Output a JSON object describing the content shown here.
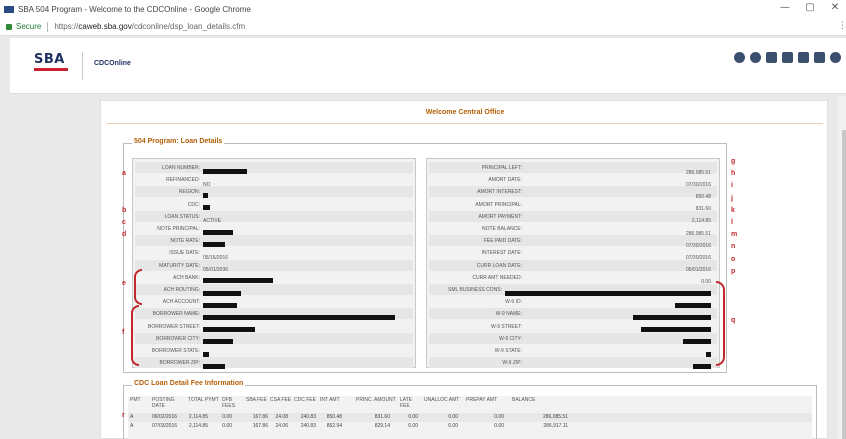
{
  "browser": {
    "window_title": "SBA 504 Program - Welcome to the CDCOnline - Google Chrome",
    "secure_label": "Secure",
    "url_prefix": "https://",
    "url_host": "caweb.sba.gov",
    "url_path": "/cdconline/dsp_loan_details.cfm"
  },
  "header": {
    "logo_text": "SBA",
    "app_name": "CDCOnline",
    "icons": [
      "user-icon",
      "help-icon",
      "chat-icon",
      "print-icon",
      "phone-icon",
      "home-icon",
      "logout-icon"
    ]
  },
  "page": {
    "welcome": "Welcome Central Office",
    "section_title": "504 Program: Loan Details",
    "fee_section_title": "CDC Loan Detail Fee Information"
  },
  "left_fields": [
    {
      "label": "LOAN NUMBER:",
      "value": "",
      "redact": 44
    },
    {
      "label": "REFINANCED:",
      "value": "NO",
      "redact": 0
    },
    {
      "label": "REGION:",
      "value": "",
      "redact": 5
    },
    {
      "label": "CDC:",
      "value": "",
      "redact": 7
    },
    {
      "label": "LOAN STATUS:",
      "value": "ACTIVE",
      "redact": 0
    },
    {
      "label": "NOTE PRINCIPAL:",
      "value": "",
      "redact": 30
    },
    {
      "label": "NOTE RATE:",
      "value": "",
      "redact": 22
    },
    {
      "label": "ISSUE DATE:",
      "value": "05/16/2016",
      "redact": 0
    },
    {
      "label": "MATURITY DATE:",
      "value": "05/01/2036",
      "redact": 0
    },
    {
      "label": "ACH BANK:",
      "value": "",
      "redact": 70
    },
    {
      "label": "ACH ROUTING:",
      "value": "",
      "redact": 38
    },
    {
      "label": "ACH ACCOUNT:",
      "value": "",
      "redact": 34
    },
    {
      "label": "BORROWER NAME:",
      "value": "",
      "redact": 192
    },
    {
      "label": "BORROWER STREET:",
      "value": "",
      "redact": 52
    },
    {
      "label": "BORROWER CITY:",
      "value": "",
      "redact": 30
    },
    {
      "label": "BORROWER STATE:",
      "value": "",
      "redact": 6
    },
    {
      "label": "BORROWER ZIP:",
      "value": "",
      "redact": 22
    }
  ],
  "right_fields": [
    {
      "label": "PRINCIPAL LEFT:",
      "value": "286,085.51",
      "redact": 0
    },
    {
      "label": "AMORT DATE:",
      "value": "07/30/2016",
      "redact": 0
    },
    {
      "label": "AMORT INTEREST:",
      "value": "850.48",
      "redact": 0
    },
    {
      "label": "AMORT PRINCIPAL:",
      "value": "831.60",
      "redact": 0
    },
    {
      "label": "AMORT PAYMENT:",
      "value": "2,114.85",
      "redact": 0
    },
    {
      "label": "NOTE BALANCE:",
      "value": "286,085.51",
      "redact": 0
    },
    {
      "label": "FEE PAID DATE:",
      "value": "07/30/2016",
      "redact": 0
    },
    {
      "label": "INTEREST DATE:",
      "value": "07/30/2016",
      "redact": 0
    },
    {
      "label": "CURR LOAN DATE:",
      "value": "05/01/2016",
      "redact": 0
    },
    {
      "label": "CURR AMT NEEDED:",
      "value": "0.00",
      "redact": 0
    },
    {
      "label": "SML BUSINESS CONS:",
      "value": "",
      "redact": 206
    },
    {
      "label": "W-9 ID:",
      "value": "",
      "redact": 36
    },
    {
      "label": "W-9 NAME:",
      "value": "",
      "redact": 78
    },
    {
      "label": "W-9 STREET:",
      "value": "",
      "redact": 70
    },
    {
      "label": "W-9 CITY:",
      "value": "",
      "redact": 28
    },
    {
      "label": "W-9 STATE:",
      "value": "",
      "redact": 5
    },
    {
      "label": "W-9 ZIP:",
      "value": "",
      "redact": 18
    }
  ],
  "annotations": {
    "left": [
      "a",
      "b",
      "c",
      "d",
      "e",
      "f"
    ],
    "right": [
      "g",
      "h",
      "i",
      "j",
      "k",
      "l",
      "m",
      "n",
      "o",
      "p",
      "q"
    ],
    "bottom": "r"
  },
  "fee_table": {
    "headers": [
      "PMT",
      "POSTING DATE",
      "TOTAL PYMT",
      "DFB FEES",
      "SBA FEE",
      "CSA FEE",
      "CDC FEE",
      "INT AMT",
      "PRINC. AMOUNT",
      "LATE FEE",
      "UNALLOC AMT",
      "PREPAY AMT",
      "BALANCE"
    ],
    "rows": [
      [
        "A",
        "06/02/2016",
        "2,114.85",
        "0.00",
        "167.86",
        "24.08",
        "240.83",
        "850.48",
        "831.60",
        "0.00",
        "0.00",
        "0.00",
        "286,085.51"
      ],
      [
        "A",
        "07/03/2016",
        "2,114.85",
        "0.00",
        "167.86",
        "24.06",
        "240.83",
        "852.94",
        "829.14",
        "0.00",
        "0.00",
        "0.00",
        "286,917.11"
      ]
    ]
  }
}
